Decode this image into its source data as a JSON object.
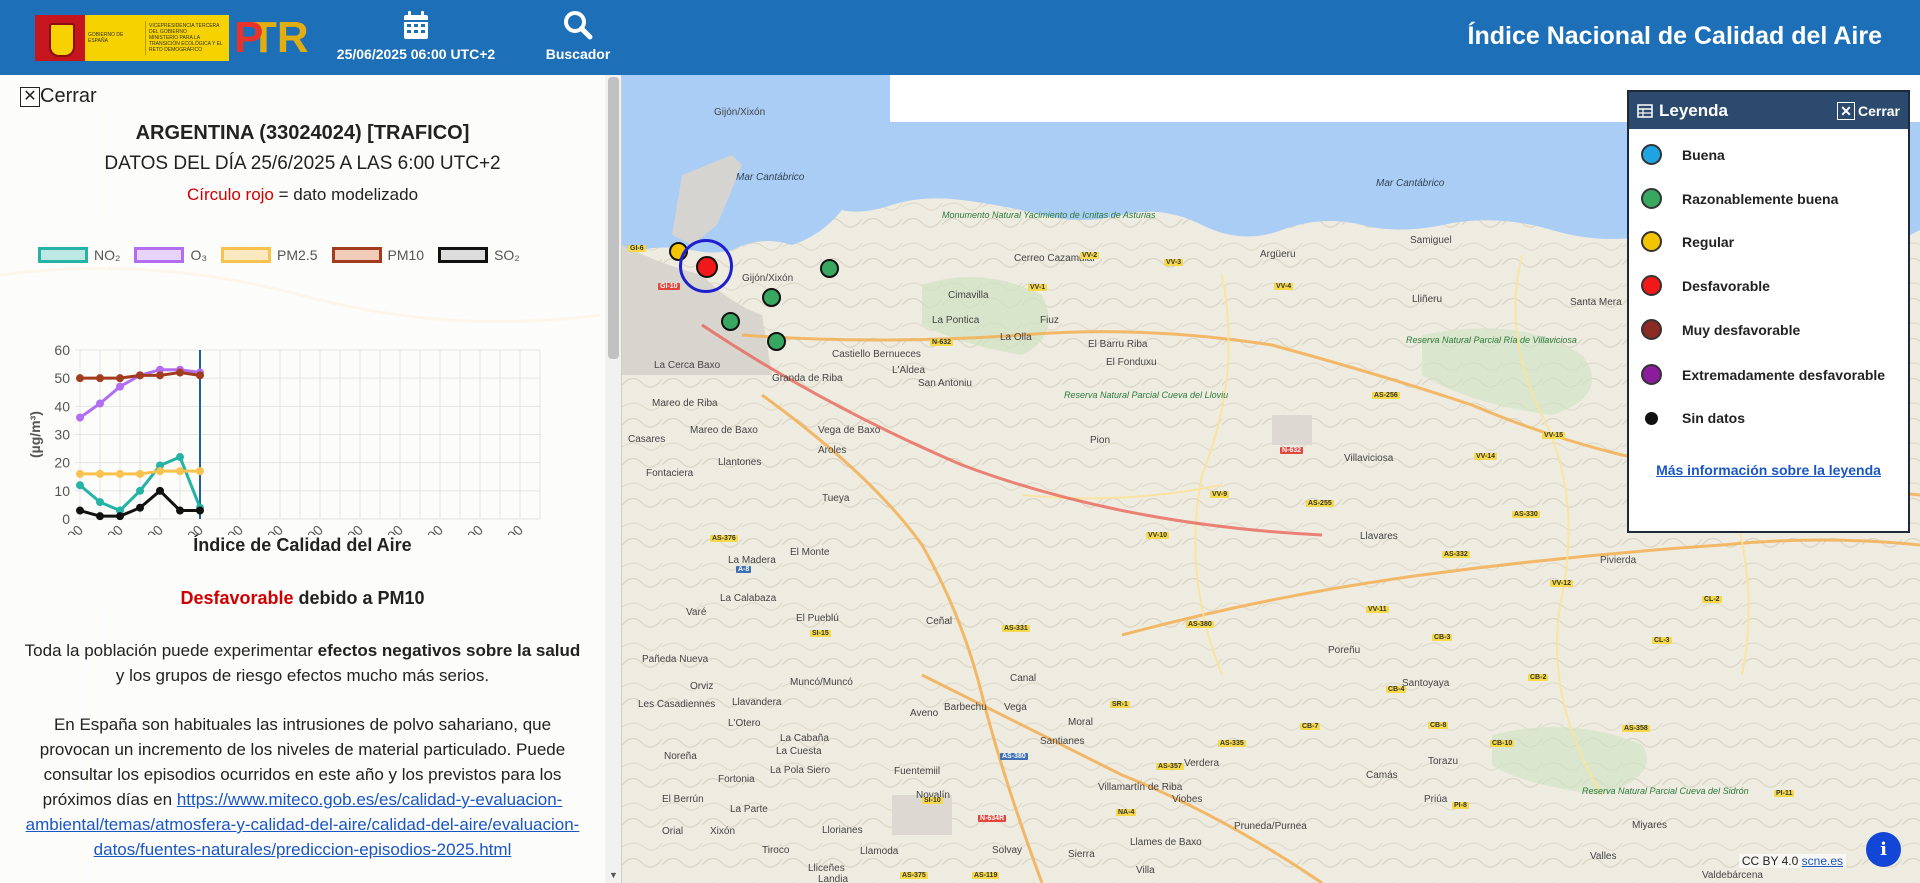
{
  "header": {
    "gov_line1": "VICEPRESIDENCIA TERCERA DEL GOBIERNO",
    "gov_line2": "MINISTERIO PARA LA TRANSICIÓN ECOLÓGICA Y EL RETO DEMOGRÁFICO",
    "gov_name": "GOBIERNO DE ESPAÑA",
    "datetime": "25/06/2025 06:00 UTC+2",
    "search_label": "Buscador",
    "title": "Índice Nacional de Calidad del Aire"
  },
  "panel": {
    "close_label": "Cerrar",
    "station_title": "ARGENTINA (33024024) [TRAFICO]",
    "data_date": "DATOS DEL DÍA 25/6/2025 A LAS 6:00 UTC+2",
    "modeled_red": "Círculo rojo",
    "modeled_rest": " = dato modelizado",
    "aqi_title": "Índice de Calidad del Aire",
    "aqi_level": "Desfavorable",
    "aqi_rest": " debido a PM10",
    "para1_a": "Toda la población puede experimentar ",
    "para1_b": "efectos negativos sobre la salud",
    "para1_c": " y los grupos de riesgo efectos mucho más serios.",
    "para2_text": "En España son habituales las intrusiones de polvo sahariano, que provocan un incremento de los niveles de material particulado. Puede consultar los episodios ocurridos en este año y los previstos para los próximos días en ",
    "para2_link": "https://www.miteco.gob.es/es/calidad-y-evaluacion-ambiental/temas/atmosfera-y-calidad-del-aire/calidad-del-aire/evaluacion-datos/fuentes-naturales/prediccion-episodios-2025.html"
  },
  "chart_data": {
    "type": "line",
    "ylabel": "(µg/m³)",
    "ylim": [
      0,
      60
    ],
    "yticks": [
      0,
      10,
      20,
      30,
      40,
      50,
      60
    ],
    "xticks": [
      "00:00",
      "02:00",
      "04:00",
      "06:00",
      "08:00",
      "10:00",
      "12:00",
      "14:00",
      "16:00",
      "18:00",
      "20:00",
      "22:00"
    ],
    "x_hours": [
      0,
      1,
      2,
      3,
      4,
      5,
      6
    ],
    "current_hour": 6,
    "series": [
      {
        "name": "NO₂",
        "color": "#25b3a6",
        "fill": "#bde8e3",
        "values": [
          12,
          6,
          3,
          10,
          19,
          22,
          4
        ]
      },
      {
        "name": "O₃",
        "color": "#b36df2",
        "fill": "#e8d3fb",
        "values": [
          36,
          41,
          47,
          51,
          53,
          53,
          52
        ]
      },
      {
        "name": "PM2.5",
        "color": "#f9c14d",
        "fill": "#fde9c0",
        "values": [
          16,
          16,
          16,
          16,
          17,
          17,
          17
        ]
      },
      {
        "name": "PM10",
        "color": "#a33c1f",
        "fill": "#f1cdb9",
        "values": [
          50,
          50,
          50,
          51,
          51,
          52,
          51
        ]
      },
      {
        "name": "SO₂",
        "color": "#111111",
        "fill": "#dddddd",
        "values": [
          3,
          1,
          1,
          4,
          10,
          3,
          3
        ]
      }
    ]
  },
  "legend": {
    "title": "Leyenda",
    "close_label": "Cerrar",
    "items": [
      {
        "label": "Buena",
        "color": "#1ea4e0"
      },
      {
        "label": "Razonablemente buena",
        "color": "#38a860"
      },
      {
        "label": "Regular",
        "color": "#f5c400"
      },
      {
        "label": "Desfavorable",
        "color": "#f01818"
      },
      {
        "label": "Muy desfavorable",
        "color": "#8a2a22"
      },
      {
        "label": "Extremadamente desfavorable",
        "color": "#8c1b9e"
      },
      {
        "label": "Sin datos",
        "color": "#111111"
      }
    ],
    "more_link": "Más información sobre la leyenda"
  },
  "map": {
    "sea_label": "Mar Cantábrico",
    "places": [
      "Gijón/Xixón",
      "Gijón/Xixón",
      "Cerreo Cazamular",
      "Cimavilla",
      "La Pontica",
      "La Olla",
      "Fiuz",
      "El Barru Riba",
      "El Fonduxu",
      "Argüeru",
      "Samiguel",
      "Lliñeru",
      "Santa Mera",
      "Castiello Bernueces",
      "L'Aldea",
      "San Antoniu",
      "La Cerca Baxo",
      "Granda de Riba",
      "Mareo de Riba",
      "Mareo de Baxo",
      "Casares",
      "Fontaciera",
      "Llantones",
      "Vega de Baxo",
      "Aroles",
      "Pion",
      "Villaviciosa",
      "Tueya",
      "Llavares",
      "Pivierda",
      "La Madera",
      "El Monte",
      "La Calabaza",
      "Varé",
      "El Pueblú",
      "Ceñal",
      "Poreñu",
      "Santoyaya",
      "Pañeda Nueva",
      "Muncó/Muncó",
      "Canal",
      "Orviz",
      "Llavandera",
      "Les Casadiennes",
      "L'Otero",
      "Barbechu",
      "Vega",
      "Moral",
      "Santianes",
      "Aveno",
      "La Cabaña",
      "La Cuesta",
      "Noreña",
      "Fortonia",
      "La Pola Siero",
      "Fuentemiil",
      "El Berrún",
      "La Parte",
      "Novalín",
      "Villamartín de Riba",
      "Viobes",
      "Verdera",
      "Camás",
      "Torazu",
      "Priúa",
      "Miyares",
      "Valles",
      "Solvay",
      "Tiroco",
      "Llamoda",
      "Llames de Baxo",
      "Pruneda/Purnea",
      "Sierra",
      "Villa",
      "Llorianes",
      "Orial",
      "Xixón",
      "Lliceñes",
      "Landia",
      "Valdebárcena"
    ],
    "reserves": [
      "Monumento Natural Yacimiento de Icnitas de Asturias",
      "Reserva Natural Parcial Ría de Villaviciosa",
      "Reserva Natural Parcial Cueva del Lloviu",
      "Reserva Natural Parcial Cueva del Sidrón"
    ],
    "roads": [
      "VV-2",
      "VV-3",
      "VV-4",
      "VV-1",
      "N-632",
      "AS-256",
      "N-632",
      "VV-15",
      "VV-14",
      "VV-9",
      "VV-10",
      "AS-255",
      "AS-330",
      "AS-332",
      "AS-376",
      "A-8",
      "VV-11",
      "VV-12",
      "CL-2",
      "CL-3",
      "CB-3",
      "CB-2",
      "CB-4",
      "AS-331",
      "AS-380",
      "SI-15",
      "SR-1",
      "CB-7",
      "CB-8",
      "AS-335",
      "CB-10",
      "AS-358",
      "AS-357",
      "AS-380",
      "SI-10",
      "N-634R",
      "NA-4",
      "PI-8",
      "PI-11",
      "AS-119",
      "AS-375",
      "GI-6",
      "GI-10"
    ],
    "attribution": "CC BY 4.0",
    "attribution_link": "scne.es",
    "info_label": "i"
  }
}
